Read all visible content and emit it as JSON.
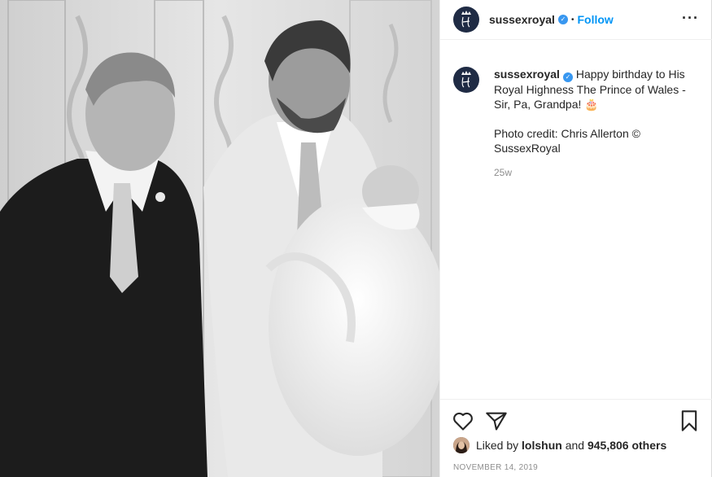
{
  "header": {
    "username": "sussexroyal",
    "separator": "•",
    "follow_label": "Follow",
    "more_label": "···"
  },
  "caption": {
    "username": "sussexroyal",
    "text": "Happy birthday to His Royal Highness The Prince of Wales - Sir, Pa, Grandpa! 🎂",
    "credit": "Photo credit: Chris Allerton © SussexRoyal",
    "age": "25w"
  },
  "likes": {
    "prefix": "Liked by",
    "user": "lolshun",
    "joiner": "and",
    "count": "945,806 others"
  },
  "post_date": "NOVEMBER 14, 2019",
  "icons": {
    "like": "heart-icon",
    "share": "paper-plane-icon",
    "save": "bookmark-icon",
    "verified": "verified-badge-icon"
  },
  "colors": {
    "accent": "#0095f6",
    "verified": "#3897f0",
    "avatar": "#1f2b44",
    "muted": "#8e8e8e"
  }
}
